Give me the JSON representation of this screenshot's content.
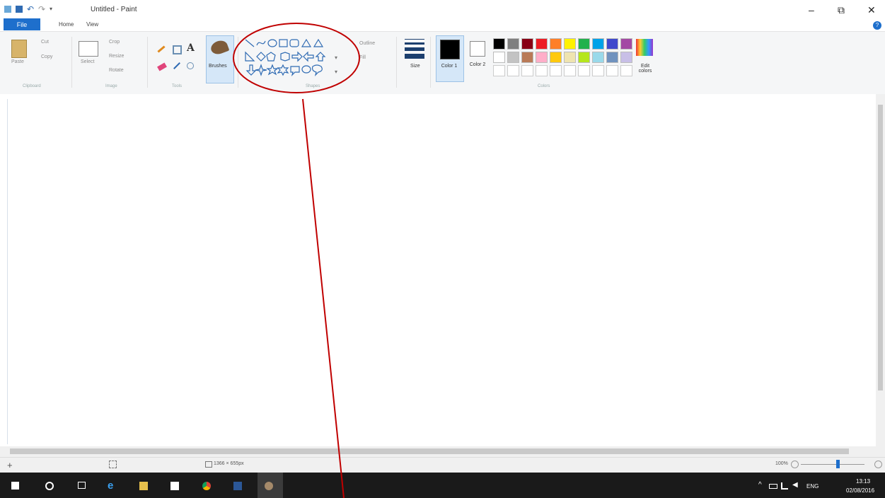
{
  "window": {
    "title": "Untitled - Paint",
    "minimize_glyph": "–",
    "maximize_glyph": "⧉",
    "close_glyph": "✕"
  },
  "tabs": {
    "file": "File",
    "home": "Home",
    "view": "View",
    "help_glyph": "?"
  },
  "ribbon": {
    "clipboard": {
      "paste": "Paste",
      "cut": "Cut",
      "copy": "Copy",
      "group": "Clipboard"
    },
    "image": {
      "select": "Select",
      "crop": "Crop",
      "resize": "Resize",
      "rotate": "Rotate",
      "group": "Image"
    },
    "tools": {
      "text_glyph": "A",
      "group": "Tools"
    },
    "brushes": {
      "label": "Brushes"
    },
    "shapes": {
      "outline": "Outline",
      "fill": "Fill",
      "group": "Shapes"
    },
    "size": {
      "label": "Size"
    },
    "colors": {
      "color1": "Color 1",
      "color2": "Color 2",
      "edit": "Edit colors",
      "group": "Colors"
    }
  },
  "palette": {
    "row1": [
      "#000000",
      "#7f7f7f",
      "#880015",
      "#ed1c24",
      "#ff7f27",
      "#fff200",
      "#22b14c",
      "#00a2e8",
      "#3f48cc",
      "#a349a4"
    ],
    "row2": [
      "#ffffff",
      "#c3c3c3",
      "#b97a57",
      "#ffaec9",
      "#ffc90e",
      "#efe4b0",
      "#b5e61d",
      "#99d9ea",
      "#7092be",
      "#c8bfe7"
    ],
    "color1": "#000000",
    "color2": "#ffffff"
  },
  "status": {
    "dimensions": "1366 × 655px",
    "zoom": "100%"
  },
  "taskbar": {
    "language": "ENG",
    "time": "13:13",
    "date": "02/08/2016"
  },
  "annotation": {
    "color": "#c00000"
  }
}
